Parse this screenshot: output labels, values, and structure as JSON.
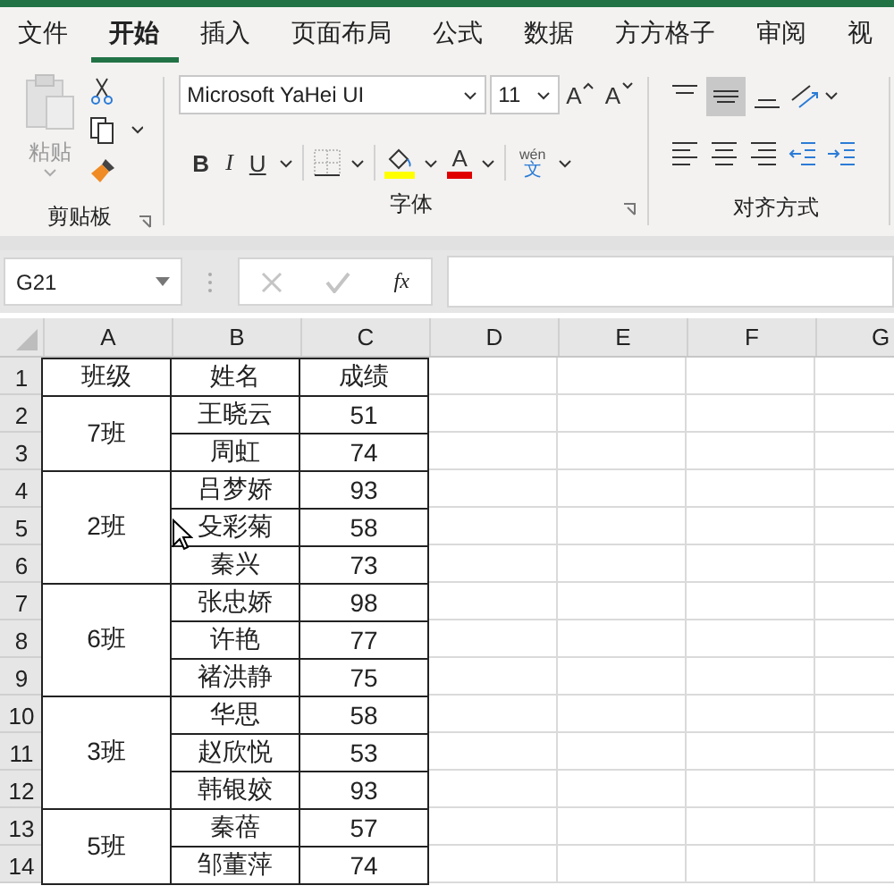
{
  "ribbon_tabs": [
    {
      "label": "文件",
      "selected": false
    },
    {
      "label": "开始",
      "selected": true
    },
    {
      "label": "插入",
      "selected": false
    },
    {
      "label": "页面布局",
      "selected": false
    },
    {
      "label": "公式",
      "selected": false
    },
    {
      "label": "数据",
      "selected": false
    },
    {
      "label": "方方格子",
      "selected": false
    },
    {
      "label": "审阅",
      "selected": false
    },
    {
      "label": "视",
      "selected": false
    }
  ],
  "clipboard": {
    "paste_label": "粘贴",
    "group_label": "剪贴板"
  },
  "font": {
    "font_name": "Microsoft YaHei UI",
    "font_size": "11",
    "grow": "A",
    "shrink": "A",
    "bold": "B",
    "italic": "I",
    "underline": "U",
    "color_letter": "A",
    "phonetic_top": "wén",
    "phonetic_bottom": "文",
    "group_label": "字体"
  },
  "alignment": {
    "group_label": "对齐方式",
    "middle_align_selected": true
  },
  "formula_bar": {
    "name_box": "G21",
    "fx": "fx"
  },
  "columns": [
    "A",
    "B",
    "C",
    "D",
    "E",
    "F",
    "G"
  ],
  "row_numbers": [
    "1",
    "2",
    "3",
    "4",
    "5",
    "6",
    "7",
    "8",
    "9",
    "10",
    "11",
    "12",
    "13",
    "14"
  ],
  "table": {
    "header": [
      "班级",
      "姓名",
      "成绩"
    ],
    "groups": [
      {
        "class": "7班",
        "students": [
          {
            "name": "王晓云",
            "score": "51"
          },
          {
            "name": "周虹",
            "score": "74"
          }
        ]
      },
      {
        "class": "2班",
        "students": [
          {
            "name": "吕梦娇",
            "score": "93"
          },
          {
            "name": "殳彩菊",
            "score": "58"
          },
          {
            "name": "秦兴",
            "score": "73"
          }
        ]
      },
      {
        "class": "6班",
        "students": [
          {
            "name": "张忠娇",
            "score": "98"
          },
          {
            "name": "许艳",
            "score": "77"
          },
          {
            "name": "褚洪静",
            "score": "75"
          }
        ]
      },
      {
        "class": "3班",
        "students": [
          {
            "name": "华思",
            "score": "58"
          },
          {
            "name": "赵欣悦",
            "score": "53"
          },
          {
            "name": "韩银姣",
            "score": "93"
          }
        ]
      },
      {
        "class": "5班",
        "students": [
          {
            "name": "秦蓓",
            "score": "57"
          },
          {
            "name": "邹董萍",
            "score": "74"
          }
        ]
      }
    ]
  }
}
